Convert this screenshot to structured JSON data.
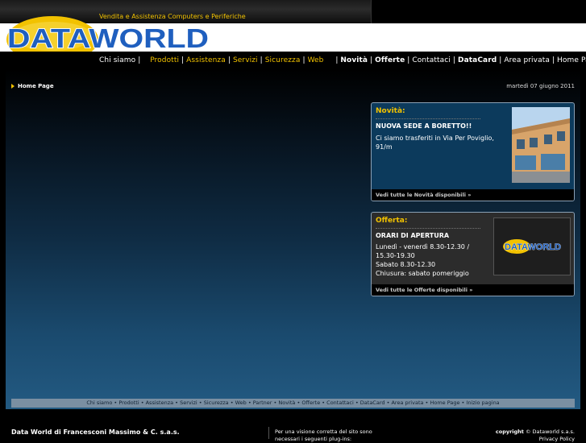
{
  "header": {
    "tagline": "Vendita e Assistenza Computers e Periferiche",
    "logo_text": "DATAWORLD"
  },
  "menu": {
    "chi_siamo": "Chi siamo",
    "prodotti": "Prodotti",
    "assistenza": "Assistenza",
    "servizi": "Servizi",
    "sicurezza": "Sicurezza",
    "web": "Web",
    "novita": "Novità",
    "offerte": "Offerte",
    "contattaci": "Contattaci",
    "datacard": "DataCard",
    "area_privata": "Area privata",
    "home_page": "Home Page"
  },
  "breadcrumb": {
    "label": "Home Page"
  },
  "date": "martedì 07 giugno 2011",
  "novita_box": {
    "title": "Novità:",
    "headline": "NUOVA SEDE A BORETTO!!",
    "text": "Ci siamo trasferiti in Via Per Poviglio, 91/m",
    "footer_link": "Vedi tutte le Novità disponibili »"
  },
  "offerta_box": {
    "title": "Offerta:",
    "headline": "ORARI DI APERTURA",
    "lines": [
      "Lunedì - venerdì 8.30-12.30 /",
      "15.30-19.30",
      "Sabato 8.30-12.30",
      "Chiusura: sabato pomeriggio"
    ],
    "footer_link": "Vedi tutte le Offerte disponibili »"
  },
  "footer_links": [
    "Chi siamo",
    "Prodotti",
    "Assistenza",
    "Servizi",
    "Sicurezza",
    "Web",
    "Partner",
    "Novità",
    "Offerte",
    "Contattaci",
    "DataCard",
    "Area privata",
    "Home Page",
    "Inizio pagina"
  ],
  "footer": {
    "company": "Data World di Francesconi Massimo & C. s.a.s.",
    "note": "Per una visione corretta del sito sono necessari i seguenti plug-ins:",
    "copyright_label": "copyright",
    "copyright_text": "© Dataworld s.a.s.",
    "privacy": "Privacy Policy"
  },
  "colors": {
    "accent_yellow": "#f2c200",
    "logo_blue": "#1f5fbf",
    "box_blue": "#0c3a5c",
    "box_dark": "#2c2c2c"
  }
}
